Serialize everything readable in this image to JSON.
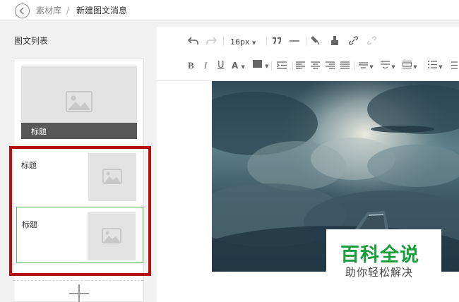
{
  "breadcrumb": {
    "parent": "素材库",
    "separator": "/",
    "current": "新建图文消息"
  },
  "sidebar": {
    "title": "图文列表",
    "cover_title": "标题",
    "items": [
      {
        "title": "标题"
      },
      {
        "title": "标题"
      }
    ]
  },
  "toolbar": {
    "font_size": "16px",
    "row1": [
      "undo-icon",
      "redo-icon",
      "font-size-select",
      "blockquote-icon",
      "horizontal-rule-icon",
      "format-brush-icon",
      "clear-format-icon",
      "link-icon",
      "unlink-icon"
    ],
    "row2": [
      "bold",
      "italic",
      "underline",
      "font-color",
      "background-color",
      "indent",
      "align-left",
      "align-center",
      "align-right",
      "align-justify",
      "line-spacing",
      "paragraph-spacing",
      "row-spacing",
      "unordered-list",
      "ordered-list"
    ]
  },
  "watermark": {
    "logo": "百科全说",
    "slogan": "助你轻松解决"
  },
  "colors": {
    "highlight": "#b40f0f",
    "selected": "#5cb85c",
    "brand": "#1a9e3c"
  }
}
